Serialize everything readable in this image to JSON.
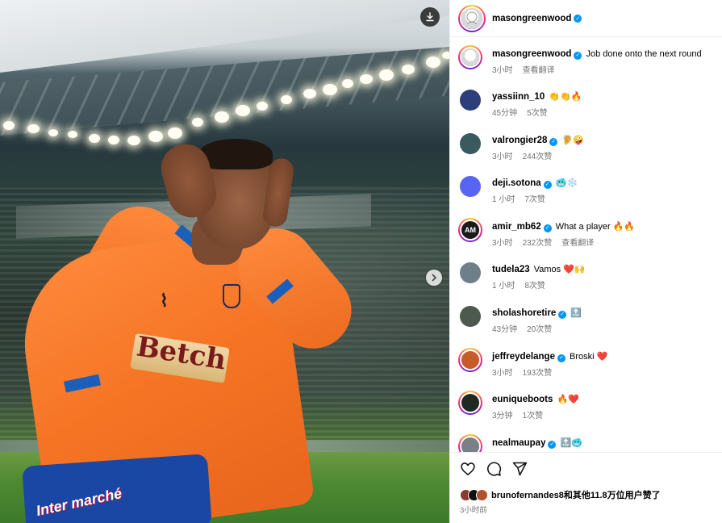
{
  "post": {
    "author": "masongreenwood",
    "verified": true,
    "caption": "Job done onto the next round",
    "caption_time": "3小时",
    "caption_translate": "查看翻译"
  },
  "photo": {
    "sponsor_text": "Betch",
    "shorts_text": "Inter marché"
  },
  "comments": [
    {
      "user": "yassiinn_10",
      "verified": false,
      "text": "👏👏🔥",
      "time": "45分钟",
      "likes": "5次赞",
      "extra": "",
      "avatar_color": "#2d3f7a"
    },
    {
      "user": "valrongier28",
      "verified": true,
      "text": "🦻🤪",
      "time": "3小时",
      "likes": "244次赞",
      "extra": "",
      "avatar_color": "#3a5a60"
    },
    {
      "user": "deji.sotona",
      "verified": true,
      "text": "🥶❄️",
      "time": "1 小时",
      "likes": "7次赞",
      "extra": "",
      "avatar_color": "#5865f2"
    },
    {
      "user": "amir_mb62",
      "verified": true,
      "text": "What a player 🔥🔥",
      "time": "3小时",
      "likes": "232次赞",
      "extra": "查看翻译",
      "avatar_color": "#1a1a1a",
      "avatar_label": "AM"
    },
    {
      "user": "tudela23",
      "verified": false,
      "text": "Vamos ❤️🙌",
      "time": "1 小时",
      "likes": "8次赞",
      "extra": "",
      "avatar_color": "#6f7f8a"
    },
    {
      "user": "sholashoretire",
      "verified": true,
      "text": "🔝",
      "time": "43分钟",
      "likes": "20次赞",
      "extra": "",
      "avatar_color": "#4b5a4d"
    },
    {
      "user": "jeffreydelange",
      "verified": true,
      "text": "Broski ❤️",
      "time": "3小时",
      "likes": "193次赞",
      "extra": "",
      "avatar_color": "#c75b2a"
    },
    {
      "user": "euniqueboots",
      "verified": false,
      "text": "🔥❤️",
      "time": "3分钟",
      "likes": "1次赞",
      "extra": "",
      "avatar_color": "#1f2a20"
    },
    {
      "user": "nealmaupay",
      "verified": true,
      "text": "🔝🥶",
      "time": "",
      "likes": "",
      "extra": "",
      "avatar_color": "#7a8088"
    }
  ],
  "likes_summary": "bruno​fernandes8和其他11.8万位用户赞了",
  "post_time": "3小时前",
  "icons": {
    "download": "download-icon",
    "next": "chevron-right-icon",
    "like": "heart-icon",
    "comment": "comment-icon",
    "share": "paper-plane-icon"
  },
  "colors": {
    "verified": "#0095f6",
    "meta_text": "#737373",
    "jersey": "#f57424"
  }
}
